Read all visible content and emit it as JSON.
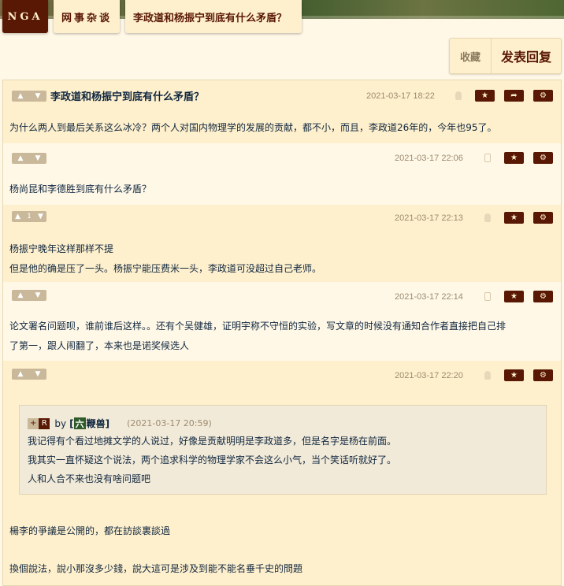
{
  "nav": {
    "logo": "NGA",
    "board": "网事杂谈",
    "thread_title": "李政道和杨振宁到底有什么矛盾？"
  },
  "actions": {
    "favorite": "收藏",
    "reply": "发表回复"
  },
  "vote_count": "1",
  "posts": [
    {
      "title": "李政道和杨振宁到底有什么矛盾？",
      "date": "2021-03-17 18:22",
      "lines": [
        "为什么两人到最后关系这么冰冷？两个人对国内物理学的发展的贡献，都不小，而且，李政道26年的，今年也95了。"
      ]
    },
    {
      "date": "2021-03-17 22:06",
      "lines": [
        "杨尚昆和李德胜到底有什么矛盾？"
      ]
    },
    {
      "date": "2021-03-17 22:13",
      "lines": [
        "杨振宁晚年这样那样不提",
        "但是他的确是压了一头。杨振宁能压费米一头，李政道可没超过自己老师。"
      ]
    },
    {
      "date": "2021-03-17 22:14",
      "lines": [
        "论文署名问题呗，谁前谁后这样。。还有个吴健雄，证明宇称不守恒的实验，写文章的时候没有通知合作者直接把自己排",
        "了第一，跟人闹翻了，本来也是诺奖候选人"
      ]
    },
    {
      "date": "2021-03-17 22:20",
      "quote": {
        "plus": "+",
        "r": "R",
        "by": "by",
        "bracket_open": "[",
        "badge": "六",
        "user": "鞭兽",
        "bracket_close": "]",
        "time": "(2021-03-17 20:59)",
        "lines": [
          "我记得有个看过地摊文学的人说过，好像是贡献明明是李政道多，但是名字是杨在前面。",
          "我其实一直怀疑这个说法，两个追求科学的物理学家不会这么小气，当个笑话听就好了。",
          "人和人合不来也没有啥问题吧"
        ]
      },
      "lines": [
        "楊李的爭議是公開的，都在訪談裏談過",
        "換個說法，說小那沒多少錢，說大這可是涉及到能不能名垂千史的問題"
      ]
    }
  ],
  "icons": {
    "vote": "thumbs-icon",
    "star": "star-icon",
    "share": "share-icon",
    "settings": "gear-icon",
    "device": "phone-icon"
  }
}
